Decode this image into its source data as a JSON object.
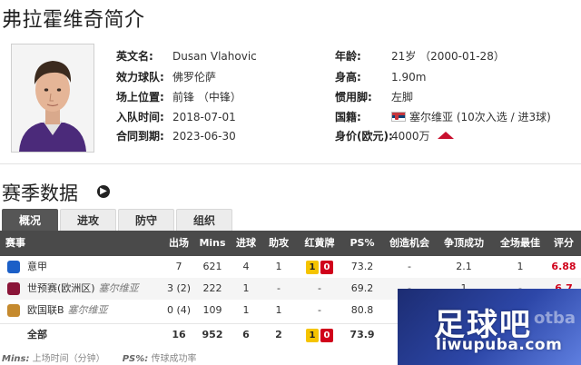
{
  "page_title": "弗拉霍维奇简介",
  "profile": {
    "left": [
      {
        "label": "英文名:",
        "value": "Dusan Vlahovic"
      },
      {
        "label": "效力球队:",
        "value": "佛罗伦萨"
      },
      {
        "label": "场上位置:",
        "value": "前锋 （中锋）"
      },
      {
        "label": "入队时间:",
        "value": "2018-07-01"
      },
      {
        "label": "合同到期:",
        "value": "2023-06-30"
      }
    ],
    "right": [
      {
        "label": "年龄:",
        "value": "21岁 （2000-01-28）"
      },
      {
        "label": "身高:",
        "value": "1.90m"
      },
      {
        "label": "惯用脚:",
        "value": "左脚"
      },
      {
        "label": "国籍:",
        "value": "塞尔维亚 (10次入选 / 进3球)"
      },
      {
        "label": "身价(欧元):",
        "value": "4000万"
      }
    ],
    "flag_icon": "serbia-flag-icon",
    "value_trend_icon": "red-up-arrow-icon"
  },
  "season": {
    "title": "赛季数据",
    "tabs": [
      "概况",
      "进攻",
      "防守",
      "组织"
    ],
    "active_tab": "概况",
    "columns": [
      "赛事",
      "出场",
      "Mins",
      "进球",
      "助攻",
      "红黄牌",
      "PS%",
      "创造机会",
      "争顶成功",
      "全场最佳",
      "评分"
    ],
    "rows": [
      {
        "comp": "意甲",
        "country": "",
        "apps": "7",
        "mins": "621",
        "goals": "4",
        "assists": "1",
        "yellow": "1",
        "red": "0",
        "ps": "73.2",
        "chances": "-",
        "aerial": "2.1",
        "motm": "1",
        "rating": "6.88",
        "icon_color": "#1b5fc7"
      },
      {
        "comp": "世预赛(欧洲区)",
        "country": "塞尔维亚",
        "apps": "3 (2)",
        "mins": "222",
        "goals": "1",
        "assists": "-",
        "yellow": "",
        "red": "",
        "ps": "69.2",
        "chances": "-",
        "aerial": "1",
        "motm": "-",
        "rating": "6.7",
        "icon_color": "#8a1538"
      },
      {
        "comp": "欧国联B",
        "country": "塞尔维亚",
        "apps": "0 (4)",
        "mins": "109",
        "goals": "1",
        "assists": "1",
        "yellow": "",
        "red": "",
        "ps": "80.8",
        "chances": "",
        "aerial": "",
        "motm": "",
        "rating": "",
        "icon_color": "#c58a2e"
      }
    ],
    "total": {
      "comp": "全部",
      "apps": "16",
      "mins": "952",
      "goals": "6",
      "assists": "2",
      "yellow": "1",
      "red": "0",
      "ps": "73.9"
    }
  },
  "footnote": {
    "mins_key": "Mins:",
    "mins_text": "上场时间（分钟）",
    "ps_key": "PS%:",
    "ps_text": "传球成功率"
  },
  "watermark": {
    "big": "足球吧",
    "url": "liwupuba.com",
    "ghost": "otba"
  }
}
